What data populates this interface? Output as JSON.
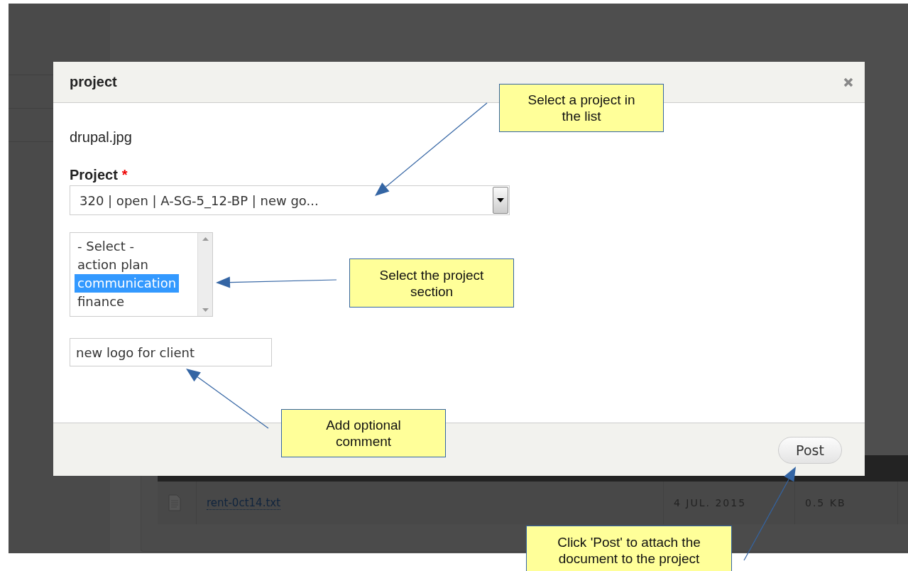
{
  "background_page": {
    "table_row": {
      "name": "rent-0ct14.txt",
      "date": "4 JUL. 2015",
      "size": "0.5 KB"
    }
  },
  "dialog": {
    "title": "project",
    "filename": "drupal.jpg",
    "project_field": {
      "label": "Project",
      "required_mark": "*",
      "value": "320 | open | A-SG-5_12-BP | new go..."
    },
    "section_list": {
      "options": [
        {
          "label": "- Select -",
          "selected": false
        },
        {
          "label": "action plan",
          "selected": false
        },
        {
          "label": "communication",
          "selected": true
        },
        {
          "label": "finance",
          "selected": false
        }
      ]
    },
    "comment": {
      "value": "new logo for client"
    },
    "post_button": "Post"
  },
  "callouts": [
    {
      "text": "Select a project in the list"
    },
    {
      "text": "Select the project section"
    },
    {
      "text": "Add optional comment"
    },
    {
      "text": "Click 'Post' to attach the document to the project"
    }
  ]
}
